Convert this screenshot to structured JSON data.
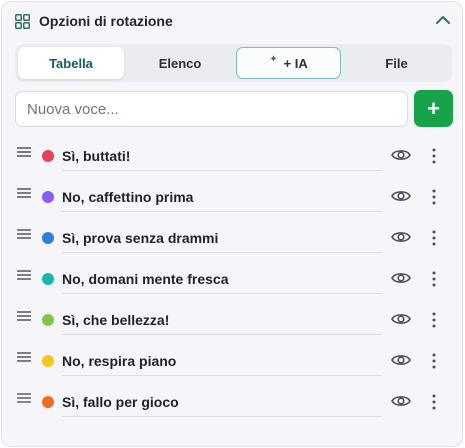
{
  "header": {
    "title": "Opzioni di rotazione",
    "grid_icon": "grid-icon",
    "collapse_icon": "chevron-up-icon"
  },
  "tabs": [
    {
      "label": "Tabella",
      "active": true
    },
    {
      "label": "Elenco",
      "active": false
    },
    {
      "label": "+ IA",
      "icon": "sparkle-icon",
      "active": false
    },
    {
      "label": "File",
      "active": false
    }
  ],
  "new_item": {
    "placeholder": "Nuova voce...",
    "value": "",
    "add_icon": "plus-icon"
  },
  "items": [
    {
      "label": "Sì, buttati!",
      "color": "#e8425b"
    },
    {
      "label": "No, caffettino prima",
      "color": "#8b5cf6"
    },
    {
      "label": "Sì, prova senza drammi",
      "color": "#2f7de1"
    },
    {
      "label": "No, domani mente fresca",
      "color": "#14b8a6"
    },
    {
      "label": "Sì, che bellezza!",
      "color": "#7ac943"
    },
    {
      "label": "No, respira piano",
      "color": "#f5c518"
    },
    {
      "label": "Sì, fallo per gioco",
      "color": "#f26b21"
    }
  ],
  "colors": {
    "accent": "#17a34a",
    "active_tab_text": "#155e52",
    "ia_border": "#7dbfb5"
  }
}
